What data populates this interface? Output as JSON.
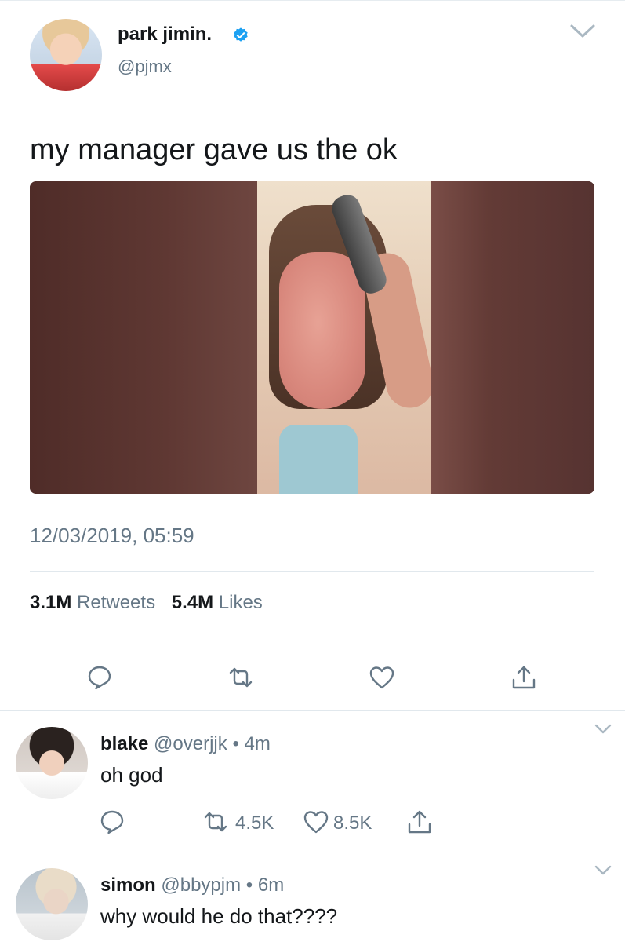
{
  "tweet": {
    "author_name": "park jimin.",
    "author_handle": "@pjmx",
    "text": "my manager gave us the ok",
    "timestamp": "12/03/2019, 05:59",
    "retweets_count": "3.1M",
    "retweets_label": "Retweets",
    "likes_count": "5.4M",
    "likes_label": "Likes"
  },
  "replies": [
    {
      "name": "blake",
      "handle": "@overjjk",
      "dot": "•",
      "time": "4m",
      "text": "oh god",
      "retweet_count": "4.5K",
      "like_count": "8.5K"
    },
    {
      "name": "simon",
      "handle": "@bbypjm",
      "dot": "•",
      "time": "6m",
      "text": "why would he do that????"
    }
  ],
  "icons": {
    "verified": "verified-badge-icon",
    "reply": "reply-icon",
    "retweet": "retweet-icon",
    "like": "heart-icon",
    "share": "share-icon",
    "more": "chevron-down-icon"
  },
  "colors": {
    "primary_text": "#14171a",
    "secondary_text": "#657786",
    "verified_blue": "#1da1f2",
    "divider": "#e1e8ed"
  }
}
